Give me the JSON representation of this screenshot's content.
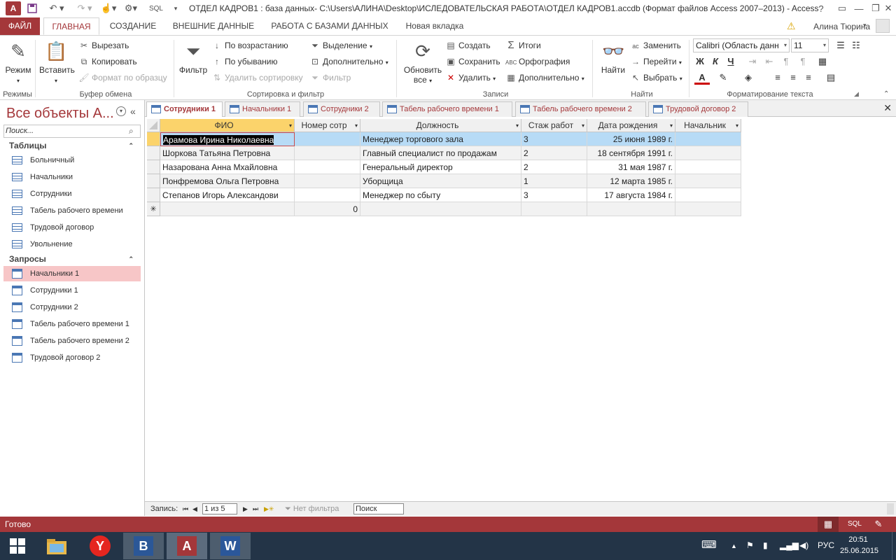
{
  "window": {
    "title": "ОТДЕЛ КАДРОВ1 : база данных- C:\\Users\\АЛИНА\\Desktop\\ИСЛЕДОВАТЕЛЬСКАЯ РАБОТА\\ОТДЕЛ КАДРОВ1.accdb (Формат файлов Access 2007–2013) - Access",
    "logo_text": "A",
    "qat_sql": "SQL"
  },
  "ribbon_tabs": {
    "file": "ФАЙЛ",
    "home": "ГЛАВНАЯ",
    "create": "СОЗДАНИЕ",
    "external": "ВНЕШНИЕ ДАННЫЕ",
    "dbtools": "РАБОТА С БАЗАМИ ДАННЫХ",
    "newtab": "Новая вкладка",
    "user": "Алина Тюрина"
  },
  "ribbon": {
    "views": {
      "mode": "Режим",
      "group": "Режимы"
    },
    "clipboard": {
      "paste": "Вставить",
      "cut": "Вырезать",
      "copy": "Копировать",
      "format_painter": "Формат по образцу",
      "group": "Буфер обмена"
    },
    "sort_filter": {
      "filter": "Фильтр",
      "ascending": "По возрастанию",
      "descending": "По убыванию",
      "remove_sort": "Удалить сортировку",
      "selection": "Выделение",
      "advanced": "Дополнительно",
      "toggle_filter": "Фильтр",
      "group": "Сортировка и фильтр"
    },
    "records": {
      "refresh": "Обновить",
      "refresh_all": "все",
      "new": "Создать",
      "save": "Сохранить",
      "delete": "Удалить",
      "totals": "Итоги",
      "spelling": "Орфография",
      "more": "Дополнительно",
      "group": "Записи"
    },
    "find": {
      "find": "Найти",
      "replace": "Заменить",
      "goto": "Перейти",
      "select": "Выбрать",
      "group": "Найти"
    },
    "text_format": {
      "font": "Calibri (Область данн",
      "size": "11",
      "bold": "Ж",
      "italic": "К",
      "underline": "Ч",
      "font_color_letter": "A",
      "group": "Форматирование текста"
    }
  },
  "nav": {
    "title": "Все объекты А...",
    "search_placeholder": "Поиск...",
    "tables_header": "Таблицы",
    "tables": [
      "Больничный",
      "Начальники",
      "Сотрудники",
      "Табель рабочего времени",
      "Трудовой договор",
      "Увольнение"
    ],
    "queries_header": "Запросы",
    "queries": [
      "Начальники 1",
      "Сотрудники 1",
      "Сотрудники 2",
      "Табель рабочего времени 1",
      "Табель рабочего времени 2",
      "Трудовой договор 2"
    ],
    "selected_query": "Начальники 1"
  },
  "doc_tabs": [
    "Сотрудники 1",
    "Начальники 1",
    "Сотрудники 2",
    "Табель рабочего времени 1",
    "Табель рабочего времени 2",
    "Трудовой договор 2"
  ],
  "grid": {
    "columns": [
      "ФИО",
      "Номер сотр",
      "Должность",
      "Стаж работ",
      "Дата рождения",
      "Начальник"
    ],
    "rows": [
      [
        "Арамова Ирина Николаевна",
        "",
        "Менеджер торгового зала",
        "3",
        "25 июня 1989 г.",
        ""
      ],
      [
        "Шоркова Татьяна Петровна",
        "",
        "Главный специалист по продажам",
        "2",
        "18 сентября 1991 г.",
        ""
      ],
      [
        "Назарована Анна Мхайловна",
        "",
        "Генеральный директор",
        "2",
        "31 мая 1987 г.",
        ""
      ],
      [
        "Понфремова Ольга Петровна",
        "",
        "Уборщица",
        "1",
        "12 марта 1985 г.",
        ""
      ],
      [
        "Степанов Игорь Александови",
        "",
        "Менеджер по сбыту",
        "3",
        "17 августа 1984 г.",
        ""
      ]
    ],
    "new_row_number": "0",
    "new_row_marker": "✳"
  },
  "record_nav": {
    "label": "Запись:",
    "position": "1 из 5",
    "no_filter": "Нет фильтра",
    "search": "Поиск"
  },
  "status": {
    "text": "Готово",
    "sql": "SQL"
  },
  "taskbar": {
    "lang": "РУС",
    "time": "20:51",
    "date": "25.06.2015",
    "yandex": "Y",
    "word_letter": "W",
    "browser_letter": "B",
    "access_letter": "A"
  },
  "colors": {
    "accent": "#a4373a",
    "selection_row": "#b7dbf6",
    "nav_selected": "#f7c6c7",
    "header_selected": "#fbd36b"
  }
}
